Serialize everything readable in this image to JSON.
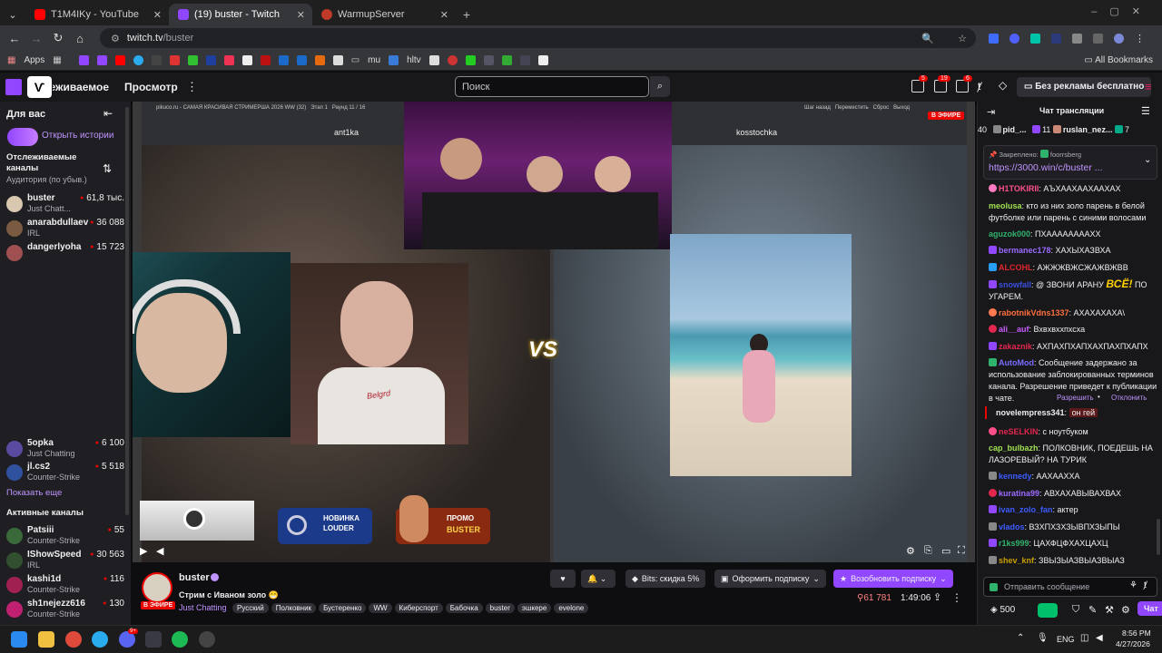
{
  "browser": {
    "tabs": [
      {
        "label": "T1M4IKу - YouTube",
        "color": "#ff0000"
      },
      {
        "label": "(19) buster - Twitch",
        "color": "#9146ff",
        "active": true
      },
      {
        "label": "WarmupServer",
        "color": "#c0392b"
      }
    ],
    "url_domain": "twitch.tv",
    "url_path": "/buster",
    "bookmarks_apps": "Apps",
    "bookmarks_folder": "mu",
    "bookmarks_hltv": "hltv",
    "all_bookmarks": "All Bookmarks"
  },
  "twitch_nav": {
    "following": "Отслеживаемое",
    "browse": "Просмотр",
    "search_placeholder": "Поиск",
    "notif_counts": [
      "5",
      "19",
      "6"
    ],
    "no_ads": "Без рекламы бесплатно"
  },
  "sidebar": {
    "for_you": "Для вас",
    "open_stories": "Открыть истории",
    "followed_title": "Отслеживаемые каналы",
    "sort": "Аудитория (по убыв.)",
    "followed": [
      {
        "name": "buster",
        "game": "Just Chatt...",
        "viewers": "61,8 тыс."
      },
      {
        "name": "anarabdullaev",
        "game": "IRL",
        "viewers": "36 088"
      },
      {
        "name": "dangerlyoha",
        "game": "",
        "viewers": "15 723"
      },
      {
        "name": "5opka",
        "game": "Just Chatting",
        "viewers": "6 100"
      },
      {
        "name": "jl.cs2",
        "game": "Counter-Strike",
        "viewers": "5 518"
      }
    ],
    "show_more": "Показать еще",
    "active_title": "Активные каналы",
    "active": [
      {
        "name": "Patsiii",
        "game": "Counter-Strike",
        "viewers": "55"
      },
      {
        "name": "IShowSpeed",
        "game": "IRL",
        "viewers": "30 563"
      },
      {
        "name": "kashi1d",
        "game": "Counter-Strike",
        "viewers": "116"
      },
      {
        "name": "sh1nejezz616",
        "game": "Counter-Strike",
        "viewers": "130"
      }
    ]
  },
  "player": {
    "top_bar": "pikuco.ru - САМАЯ КРАСИВАЯ СТРИМЕРША 2026 WW (32)   Этап 1   Раунд 11 / 16",
    "top_right": "Шаг назад   Переместить   Сброс   Выход",
    "live": "В ЭФИРЕ",
    "left_name": "ant1ka",
    "right_name": "kosstochka",
    "vs": "VS",
    "sweater": "Belgrd",
    "promo1_line1": "НОВИНКА",
    "promo1_line2": "LOUDER",
    "promo2_line1": "ПРОМО",
    "promo2_line2": "BUSTER"
  },
  "stream_info": {
    "channel": "buster",
    "title": "Стрим с Иваном золо 😁",
    "live_badge": "В ЭФИРЕ",
    "category": "Just Chatting",
    "tags": [
      "Русский",
      "Полковник",
      "Бустеренко",
      "WW",
      "Киберспорт",
      "Бабочка",
      "buster",
      "эшкере",
      "evelone"
    ],
    "bits": "Bits: скидка 5%",
    "subscribe": "Оформить подписку",
    "gift": "Возобновить подписку",
    "viewers": "61 781",
    "uptime": "1:49:06"
  },
  "chat": {
    "title": "Чат трансляции",
    "top_count": "40",
    "top_user1": "pid_...",
    "top_count2": "11",
    "top_user2": "ruslan_nez...",
    "top_count3": "7",
    "pinned_label": "Закреплено:",
    "pinned_by": "foorrsberg",
    "pinned_link": "https://3000.win/c/buster ...",
    "messages": [
      {
        "user": "H1TOKIRII",
        "text": ": АЪХААХААХААХАХ",
        "color": "#ff4f8b"
      },
      {
        "user": "meolusa",
        "text": ": кто из них золо парень в белой футболке или парень с синими волосами",
        "color": "#a0e050"
      },
      {
        "user": "aguzok000",
        "text": ": ПХААААААААХХ",
        "color": "#2fb26d"
      },
      {
        "user": "bermanec178",
        "text": ": ХАХЫХАЗВХА",
        "color": "#9b6bff"
      },
      {
        "user": "ALCOHL",
        "text": ": АЖЖЖВЖСЖАЖВЖВВ",
        "color": "#e0262b"
      },
      {
        "user": "snowfall",
        "text": ": @ ЗВОНИ АРАНУ",
        "emote": "ВСЁ!",
        "tail": "ПО УГАРЕМ.",
        "color": "#3a4fe0"
      },
      {
        "user": "rabotnikVdns1337",
        "text": ": АХАХАХАХА\\",
        "color": "#ff6f3d"
      },
      {
        "user": "ali__auf",
        "text": ": Вхвхвххпхсха",
        "color": "#cc5cff"
      },
      {
        "user": "zakaznik",
        "text": ": АХПАХПХАПХАХПАХПХАПХ",
        "color": "#e2264d"
      },
      {
        "user": "AutoMod",
        "text": ": Сообщение задержано за использование заблокированных терминов канала. Разрешение приведет к публикации в чате.",
        "color": "#7b6bff"
      },
      {
        "user": "novelempress341",
        "text": "он гей",
        "color": "#efeff1"
      },
      {
        "user": "neSELKIN",
        "text": ": с ноутбуком",
        "color": "#e2264d"
      },
      {
        "user": "cap_bulbazh",
        "text": ": ПОЛКОВНИК, ПОЕДЕШЬ НА ЛАЗОРЕВЫЙ? НА ТУРИК",
        "color": "#a0e050"
      },
      {
        "user": "kennedy",
        "text": ": ААХААХХА",
        "color": "#3d5cff"
      },
      {
        "user": "kuratina99",
        "text": ": АВХАХАВЫВАХВАХ",
        "color": "#9b6bff"
      },
      {
        "user": "ivan_zolo_fan",
        "text": ": актер",
        "color": "#3d5cff"
      },
      {
        "user": "vlados",
        "text": ": ВЗХПХЗХЗЫВПХЗЫПЫ",
        "color": "#3d5cff"
      },
      {
        "user": "r1ks999",
        "text": ": ЦАХФЦФХАХЦАХЦ",
        "color": "#2fb26d"
      },
      {
        "user": "shev_knf",
        "text": ": ЗВЫЗЫАЗВЫАЗВЫАЗ",
        "color": "#c9a000"
      }
    ],
    "allow": "Разрешить",
    "deny": "Отклонить",
    "send_placeholder": "Отправить сообщение",
    "points": "500",
    "chat_btn": "Чат"
  },
  "taskbar": {
    "lang": "ENG",
    "time": "8:56 PM",
    "date": "4/27/2026",
    "discord_badge": "9+"
  },
  "colors": {
    "twitch_purple": "#9146ff",
    "live_red": "#eb0400",
    "link_purple": "#bf94ff"
  }
}
